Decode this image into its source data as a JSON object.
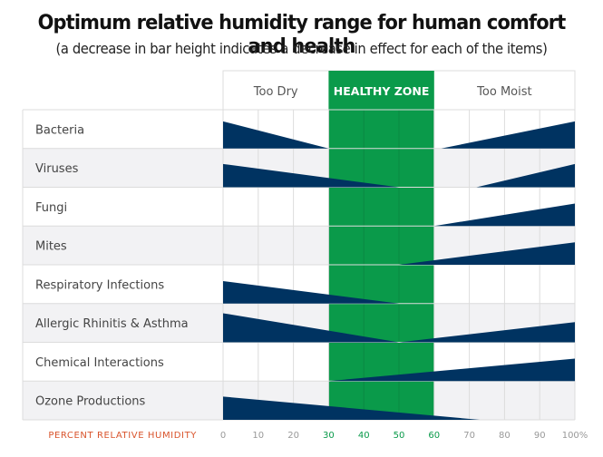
{
  "chart_data": {
    "type": "area",
    "title": "Optimum relative humidity range for human comfort and health",
    "subtitle": "(a decrease in bar height indicates a decrease in effect for each of the items)",
    "xlabel": "PERCENT RELATIVE HUMIDITY",
    "xlim": [
      0,
      100
    ],
    "x_ticks": [
      "0",
      "10",
      "20",
      "30",
      "40",
      "50",
      "60",
      "70",
      "80",
      "90",
      "100%"
    ],
    "x_tick_values": [
      0,
      10,
      20,
      30,
      40,
      50,
      60,
      70,
      80,
      90,
      100
    ],
    "highlighted_ticks": [
      30,
      40,
      50,
      60
    ],
    "zones": [
      {
        "label": "Too Dry",
        "from": 0,
        "to": 30
      },
      {
        "label": "HEALTHY ZONE",
        "from": 30,
        "to": 60,
        "highlight": true
      },
      {
        "label": "Too Moist",
        "from": 60,
        "to": 100
      }
    ],
    "rows": [
      {
        "label": "Bacteria",
        "segments": [
          {
            "from": 0,
            "to": 30,
            "start": 0.7,
            "end": 0
          },
          {
            "from": 62,
            "to": 100,
            "start": 0,
            "end": 0.7
          }
        ]
      },
      {
        "label": "Viruses",
        "segments": [
          {
            "from": 0,
            "to": 50,
            "start": 0.6,
            "end": 0
          },
          {
            "from": 72,
            "to": 100,
            "start": 0,
            "end": 0.6
          }
        ]
      },
      {
        "label": "Fungi",
        "segments": [
          {
            "from": 60,
            "to": 100,
            "start": 0,
            "end": 0.58
          }
        ]
      },
      {
        "label": "Mites",
        "segments": [
          {
            "from": 50,
            "to": 100,
            "start": 0,
            "end": 0.58
          }
        ]
      },
      {
        "label": "Respiratory Infections",
        "segments": [
          {
            "from": 0,
            "to": 50,
            "start": 0.58,
            "end": 0
          }
        ]
      },
      {
        "label": "Allergic Rhinitis & Asthma",
        "segments": [
          {
            "from": 0,
            "to": 50,
            "start": 0.75,
            "end": 0
          },
          {
            "from": 50,
            "to": 100,
            "start": 0,
            "end": 0.52
          }
        ]
      },
      {
        "label": "Chemical Interactions",
        "segments": [
          {
            "from": 30,
            "to": 100,
            "start": 0,
            "end": 0.58
          }
        ]
      },
      {
        "label": "Ozone Productions",
        "segments": [
          {
            "from": 0,
            "to": 73,
            "start": 0.6,
            "end": 0
          }
        ]
      }
    ],
    "grid": true,
    "colors": {
      "bar": "#003361",
      "healthy_zone": "#0a9a4a",
      "row_alt": "#f2f2f4",
      "grid": "#dcdcdc",
      "axis_title": "#d9542c"
    }
  }
}
